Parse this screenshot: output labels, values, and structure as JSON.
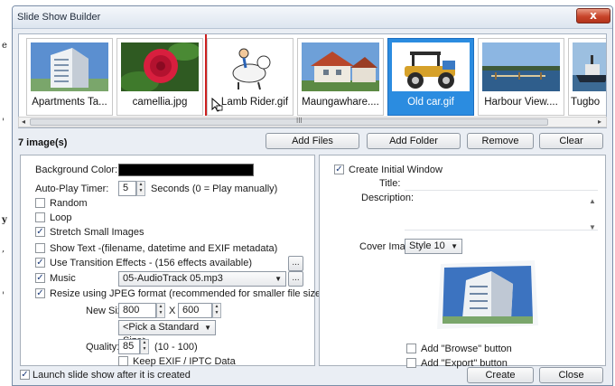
{
  "window": {
    "title": "Slide Show Builder",
    "close_glyph": "x"
  },
  "left_strip": {
    "chars": [
      "e",
      "'",
      "y",
      ",",
      "'"
    ]
  },
  "thumbnails": [
    {
      "label": "Apartments Ta...",
      "icon": "building-photo"
    },
    {
      "label": "camellia.jpg",
      "icon": "flower-photo"
    },
    {
      "label": "Lamb Rider.gif",
      "icon": "cartoon-lamb"
    },
    {
      "label": "Maungawhare....",
      "icon": "house-photo"
    },
    {
      "label": "Old car.gif",
      "icon": "cartoon-car",
      "selected": true
    },
    {
      "label": "Harbour View....",
      "icon": "harbour-photo"
    },
    {
      "label": "Tugbo",
      "icon": "boat-photo"
    }
  ],
  "scrollbar": {
    "grip": "III",
    "left_arrow": "◂",
    "right_arrow": "▸"
  },
  "image_count": "7 image(s)",
  "buttons": {
    "add_files": "Add Files",
    "add_folder": "Add Folder",
    "remove": "Remove",
    "clear": "Clear",
    "create": "Create",
    "close": "Close"
  },
  "settings": {
    "background_color_label": "Background Color:",
    "background_color_value": "#000000",
    "autoplay_label": "Auto-Play Timer:",
    "autoplay_value": "5",
    "autoplay_suffix": "Seconds (0 = Play  manually)",
    "random_label": "Random",
    "loop_label": "Loop",
    "stretch_label": "Stretch Small Images",
    "show_text_label": "Show Text -(filename, datetime and EXIF metadata)",
    "transition_label": "Use Transition Effects   -   (156 effects available)",
    "music_label": "Music",
    "music_value": "05-AudioTrack 05.mp3",
    "resize_label": "Resize using JPEG format (recommended for smaller file size)",
    "new_size_label": "New Size:",
    "width_value": "800",
    "x_label": "X",
    "height_value": "600",
    "standard_size": "<Pick a Standard Size>",
    "quality_label": "Quality:",
    "quality_value": "85",
    "quality_range": "(10 - 100)",
    "keep_exif_label": "Keep EXIF / IPTC Data",
    "ellipsis": "..."
  },
  "initial_window": {
    "create_label": "Create Initial Window",
    "title_label": "Title:",
    "title_value": "",
    "description_label": "Description:",
    "description_value": "",
    "cover_label": "Cover Image:",
    "cover_value": "Style 10",
    "browse_label": "Add \"Browse\" button",
    "export_label": "Add \"Export\" button"
  },
  "launch_label": "Launch slide show after it is created",
  "check_glyph": "✓"
}
